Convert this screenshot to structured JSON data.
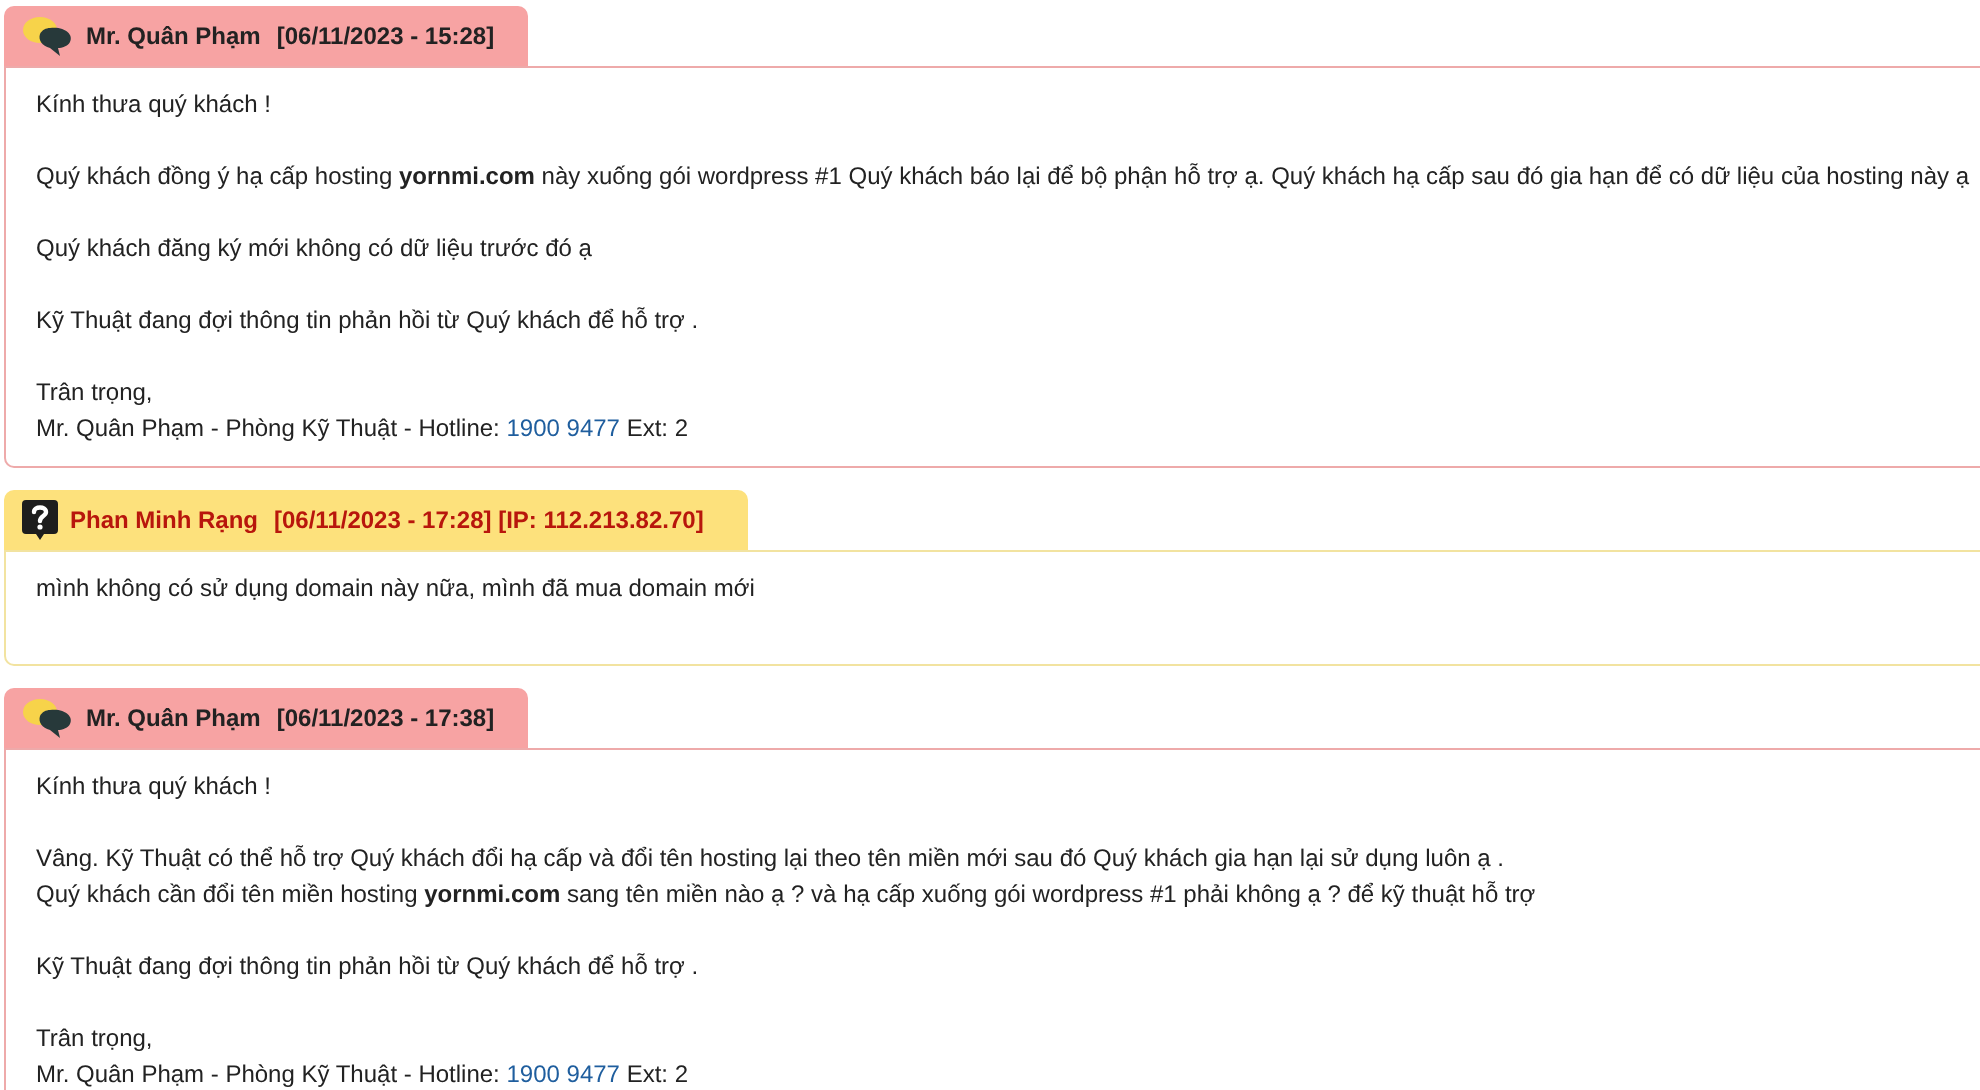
{
  "messages": [
    {
      "kind": "staff",
      "name": "Mr. Quân Phạm",
      "meta": "[06/11/2023 - 15:28]",
      "blocks": [
        [
          "Kính thưa quý khách !"
        ],
        [
          "Quý khách đồng ý hạ cấp hosting **yornmi.com** này xuống gói wordpress #1 Quý khách báo lại để bộ phận hỗ trợ ạ. Quý khách hạ cấp sau đó gia hạn để có dữ liệu của hosting này ạ"
        ],
        [
          "Quý khách đăng ký mới không có dữ liệu trước đó ạ"
        ],
        [
          "Kỹ Thuật đang đợi thông tin phản hồi từ Quý khách để hỗ trợ ."
        ]
      ],
      "signature": {
        "closing": "Trân trọng,",
        "prefix": "Mr. Quân Phạm - Phòng Kỹ Thuật - Hotline:",
        "phone": "1900 9477",
        "suffix": "Ext: 2"
      }
    },
    {
      "kind": "client",
      "name": "Phan Minh Rạng",
      "meta": "[06/11/2023 - 17:28] [IP: 112.213.82.70]",
      "blocks": [
        [
          "mình không có sử dụng domain này nữa, mình đã mua domain mới"
        ]
      ]
    },
    {
      "kind": "staff",
      "name": "Mr. Quân Phạm",
      "meta": "[06/11/2023 - 17:38]",
      "blocks": [
        [
          "Kính thưa quý khách !"
        ],
        [
          "Vâng. Kỹ Thuật có thể hỗ trợ Quý khách đổi hạ cấp và đổi tên hosting lại theo tên miền mới sau đó Quý khách gia hạn lại sử dụng luôn ạ .",
          "Quý khách cần đổi tên miền hosting **yornmi.com** sang tên miền nào  ạ ? và hạ cấp xuống gói wordpress #1 phải không ạ ? để kỹ thuật hỗ trợ"
        ],
        [
          "Kỹ Thuật đang đợi thông tin phản hồi từ Quý khách để hỗ trợ ."
        ]
      ],
      "signature": {
        "closing": "Trân trọng,",
        "prefix": "Mr. Quân Phạm - Phòng Kỹ Thuật - Hotline:",
        "phone": "1900 9477",
        "suffix": "Ext: 2"
      }
    }
  ]
}
